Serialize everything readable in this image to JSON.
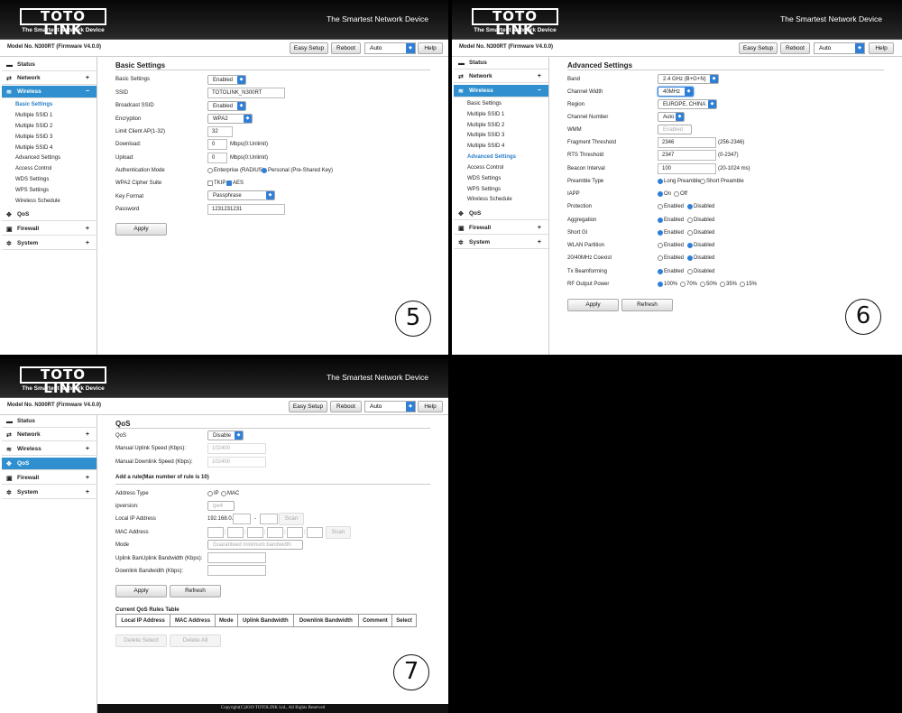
{
  "header": {
    "logo": "TOTO LINK",
    "logo_sub": "The Smartest Network Device",
    "slogan": "The Smartest Network Device",
    "model": "Model No. N300RT (Firmware V4.0.0)",
    "easy_setup": "Easy Setup",
    "reboot": "Reboot",
    "language": "Auto",
    "help": "Help"
  },
  "menu": {
    "status": "Status",
    "network": "Network",
    "wireless": "Wireless",
    "qos": "QoS",
    "firewall": "Firewall",
    "system": "System",
    "plus": "+",
    "minus": "−",
    "wireless_sub": [
      "Basic Settings",
      "Multiple SSID 1",
      "Multiple SSID 2",
      "Multiple SSID 3",
      "Multiple SSID 4",
      "Advanced Settings",
      "Access Control",
      "WDS Settings",
      "WPS Settings",
      "Wireless Schedule"
    ]
  },
  "panel5": {
    "number": "5",
    "title": "Basic Settings",
    "basic_settings_label": "Basic Settings",
    "basic_settings_value": "Enabled",
    "ssid_label": "SSID",
    "ssid_value": "TOTOLINK_N300RT",
    "broadcast_label": "Broadcast SSID",
    "broadcast_value": "Enabled",
    "encryption_label": "Encryption",
    "encryption_value": "WPA2",
    "limit_label": "Limit Client AP(1-32)",
    "limit_value": "32",
    "download_label": "Download:",
    "download_value": "0",
    "download_unit": "Mbps(0:Unlimit)",
    "upload_label": "Upload:",
    "upload_value": "0",
    "upload_unit": "Mbps(0:Unlimit)",
    "auth_label": "Authentication Mode",
    "auth_opt1": "Enterprise (RADIUS)",
    "auth_opt2": "Personal (Pre-Shared Key)",
    "cipher_label": "WPA2 Cipher Suite",
    "cipher_opt1": "TKIP",
    "cipher_opt2": "AES",
    "keyformat_label": "Key Format",
    "keyformat_value": "Passphrase",
    "password_label": "Password",
    "password_value": "1231231231",
    "apply": "Apply"
  },
  "panel6": {
    "number": "6",
    "title": "Advanced Settings",
    "band_label": "Band",
    "band_value": "2.4 GHz (B+G+N)",
    "width_label": "Channel Width",
    "width_value": "40MHz",
    "region_label": "Region",
    "region_value": "EUROPE, CHINA",
    "chnum_label": "Channel Number",
    "chnum_value": "Auto",
    "wmm_label": "WMM",
    "wmm_value": "Enabled",
    "frag_label": "Fragment Threshold",
    "frag_value": "2346",
    "frag_range": "(256-2346)",
    "rts_label": "RTS Threshold",
    "rts_value": "2347",
    "rts_range": "(0-2347)",
    "beacon_label": "Beacon Interval",
    "beacon_value": "100",
    "beacon_range": "(20-1024 ms)",
    "preamble_label": "Preamble Type",
    "preamble_opt1": "Long Preamble",
    "preamble_opt2": "Short Preamble",
    "iapp_label": "IAPP",
    "on": "On",
    "off": "Off",
    "protection_label": "Protection",
    "aggregation_label": "Aggregation",
    "shortgi_label": "Short GI",
    "partition_label": "WLAN Partition",
    "coexist_label": "20/40MHz Coexist",
    "beamform_label": "Tx Beamforming",
    "enabled": "Enabled",
    "disabled": "Disabled",
    "rfpower_label": "RF Output Power",
    "rf_opts": [
      "100%",
      "70%",
      "50%",
      "35%",
      "15%"
    ],
    "apply": "Apply",
    "refresh": "Refresh"
  },
  "panel7": {
    "number": "7",
    "title": "QoS",
    "qos_label": "QoS",
    "qos_value": "Disable",
    "uplink_label": "Manual Uplink Speed (Kbps):",
    "uplink_value": "102400",
    "downlink_label": "Manual Downlink Speed (Kbps):",
    "downlink_value": "102400",
    "rule_title": "Add a rule(Max number of rule is 10)",
    "addr_type_label": "Address Type",
    "addr_ip": "IP",
    "addr_mac": "MAC",
    "ipversion_label": "ipversion:",
    "ipversion_value": "ipv4",
    "local_ip_label": "Local IP Address",
    "local_ip_prefix": "192.168.0.",
    "dash": "-",
    "scan": "Scan",
    "mac_label": "MAC Address",
    "colon": ":",
    "mode_label": "Mode",
    "mode_value": "Guaranteed minimum bandwidth",
    "up_bw_label": "Uplink BanUplink Bandwidth (Kbps):",
    "down_bw_label": "Downlink Bandwidth (Kbps):",
    "apply": "Apply",
    "refresh": "Refresh",
    "table_title": "Current QoS Rules Table",
    "table_headers": [
      "Local IP Address",
      "MAC Address",
      "Mode",
      "Uplink Bandwidth",
      "Downlink Bandwidth",
      "Comment",
      "Select"
    ],
    "delete_select": "Delete Select",
    "delete_all": "Delete All",
    "footer": "Copyright(C)2019 TOTOLINK Ltd., All Rights Reserved"
  },
  "colors": {
    "accent": "#3090cf",
    "header": "#111111"
  },
  "icons": [
    "status-icon",
    "network-icon",
    "wireless-icon",
    "qos-icon",
    "firewall-icon",
    "system-icon"
  ]
}
